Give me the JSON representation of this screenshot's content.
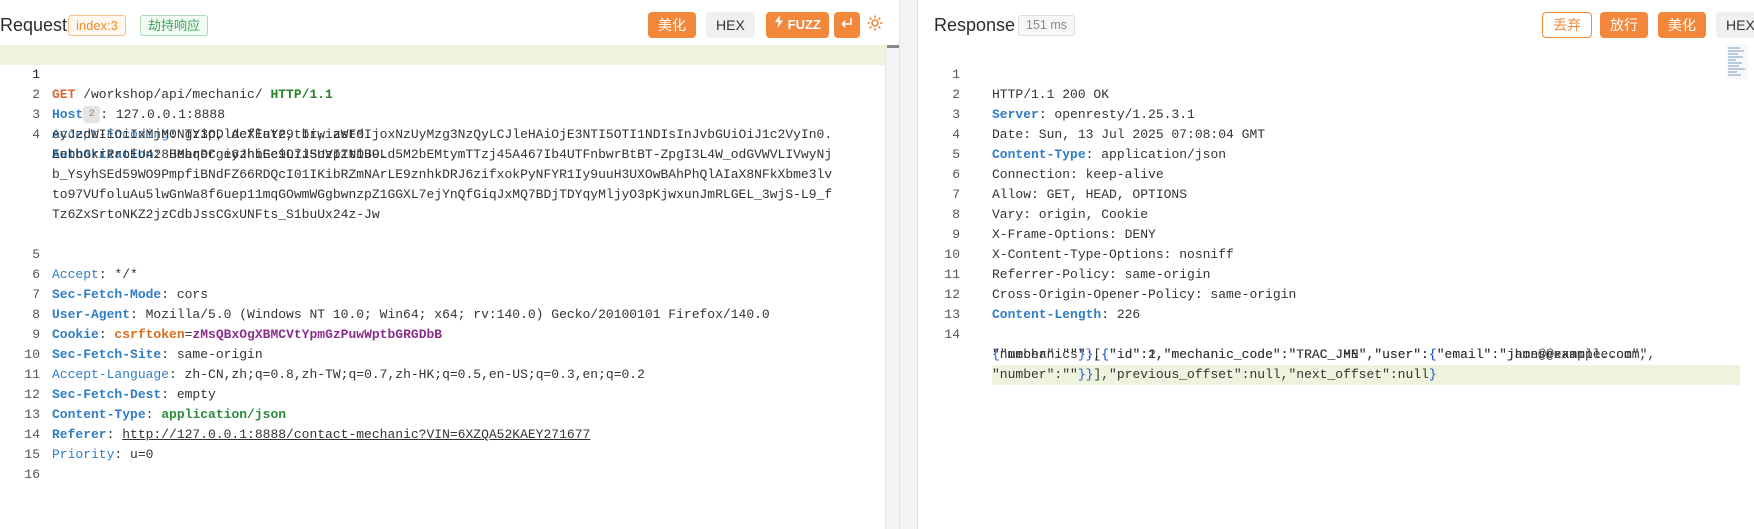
{
  "request": {
    "title": "Request",
    "index_tag": "index:3",
    "intercept_tag": "劫持响应",
    "beautify_label": "美化",
    "hex_label": "HEX",
    "fuzz_label": "FUZZ",
    "line_numbers": [
      "1",
      "2",
      "3",
      "4",
      "5",
      "6",
      "7",
      "8",
      "9",
      "10",
      "11",
      "12",
      "13",
      "14",
      "15",
      "16"
    ],
    "lines": {
      "l1": {
        "method": "GET",
        "path": " /workshop/api/mechanic/ ",
        "proto": "HTTP/1.1"
      },
      "l2": {
        "key": "Host",
        "badge": "2",
        "value": ": 127.0.0.1:8888"
      },
      "l3": {
        "key": "Accept-Encoding",
        "value": ": gzip, deflate, br, zstd"
      },
      "l4": {
        "key": "Authorization",
        "value": ": Bearer eyJhbGciOiJSUzI1NiJ9.",
        "wrap": [
          "eyJzdWIiOiIxMjM0NTY3ODlAcXEuY29tIiwiaWF0IjoxNzUyMzg3NzQyLCJleHAiOjE3NTI5OTI1NDIsInJvbGUiOiJ1c2VyIn0.",
          "EebbGkrRroEU428HMbqDCgi6zhiEe9L7i5nVpZtDBOLd5M2bEMtymTTzj45A467Ib4UTFnbwrBtBT-ZpgI3L4W_odGVWVLIVwyNj",
          "b_YsyhSEd59WO9PmpfiBNdFZ66RDQcI01IKibRZmNArLE9znhkDRJ6zifxokPyNFYR1Iy9uuH3UXOwBAhPhQlAIaX8NFkXbme3lv",
          "to97VUfoluAu5lwGnWa8f6uep11mqGOwmWGgbwnzpZ1GGXL7ejYnQfGiqJxMQ7BDjTDYqyMljyO3pKjwxunJmRLGEL_3wjS-L9_f",
          "Tz6ZxSrtoNKZ2jzCdbJssCGxUNFts_S1buUx24z-Jw"
        ]
      },
      "l5": {
        "key": "Accept",
        "value": ": */*"
      },
      "l6": {
        "key": "Sec-Fetch-Mode",
        "value": ": cors"
      },
      "l7": {
        "key": "User-Agent",
        "value": ": Mozilla/5.0 (Windows NT 10.0; Win64; x64; rv:140.0) Gecko/20100101 Firefox/140.0"
      },
      "l8": {
        "key": "Cookie",
        "sep": ": ",
        "cookie_name": "csrftoken",
        "eq": "=",
        "cookie_value": "zMsQBxOgXBMCVtYpmGzPuwWptbGRGDbB"
      },
      "l9": {
        "key": "Sec-Fetch-Site",
        "value": ": same-origin"
      },
      "l10": {
        "key": "Accept-Language",
        "value": ": zh-CN,zh;q=0.8,zh-TW;q=0.7,zh-HK;q=0.5,en-US;q=0.3,en;q=0.2"
      },
      "l11": {
        "key": "Sec-Fetch-Dest",
        "value": ": empty"
      },
      "l12": {
        "key": "Content-Type",
        "sep": ": ",
        "value": "application/json"
      },
      "l13": {
        "key": "Referer",
        "sep": ": ",
        "link": "http://127.0.0.1:8888/contact-mechanic?VIN=6XZQA52KAEY271677"
      },
      "l14": {
        "key": "Priority",
        "value": ": u=0"
      }
    }
  },
  "response": {
    "title": "Response",
    "time_tag": "151 ms",
    "discard_label": "丢弃",
    "release_label": "放行",
    "beautify_label": "美化",
    "hex_label": "HEX",
    "line_numbers": [
      "1",
      "2",
      "3",
      "4",
      "5",
      "6",
      "7",
      "8",
      "9",
      "10",
      "11",
      "12",
      "13",
      "14"
    ],
    "lines": {
      "l1": "HTTP/1.1 200 OK",
      "l2": {
        "key": "Server",
        "value": ": openresty/1.25.3.1"
      },
      "l3": "Date: Sun, 13 Jul 2025 07:08:04 GMT",
      "l4": {
        "key": "Content-Type",
        "value": ": application/json"
      },
      "l5": "Connection: keep-alive",
      "l6": "Allow: GET, HEAD, OPTIONS",
      "l7": "Vary: origin, Cookie",
      "l8": "X-Frame-Options: DENY",
      "l9": "X-Content-Type-Options: nosniff",
      "l10": "Referrer-Policy: same-origin",
      "l11": "Cross-Origin-Opener-Policy: same-origin",
      "l12": {
        "key": "Content-Length",
        "value": ": 226"
      },
      "l14": {
        "a1": "{",
        "a2": "\"mechanics\":[",
        "a3": "{",
        "a4": "\"id\":1,\"mechanic_code\":\"TRAC_JHN\",\"user\":",
        "a5": "{",
        "a6": "\"email\":\"jhon@example.com\",",
        "b1": "\"number\":\"\"",
        "b2": "}}",
        "b3": ",",
        "b4": "{",
        "b5": "\"id\":2,\"mechanic_code\":\"TRAC_JME\",\"user\":",
        "b6": "{",
        "b7": "\"email\":\"james@example.com\",",
        "c1": "\"number\":\"\"",
        "c2": "}}",
        "c3": "],\"previous_offset\":null,\"next_offset\":null",
        "c4": "}"
      }
    }
  },
  "colors": {
    "accent_orange": "#f3873b",
    "header_key_blue": "#2f7dc6",
    "highlight_line": "#eef3dd"
  },
  "icons": {
    "fuzz": "lightning-icon",
    "wrap": "return-arrow-icon",
    "settings": "gear-icon"
  }
}
